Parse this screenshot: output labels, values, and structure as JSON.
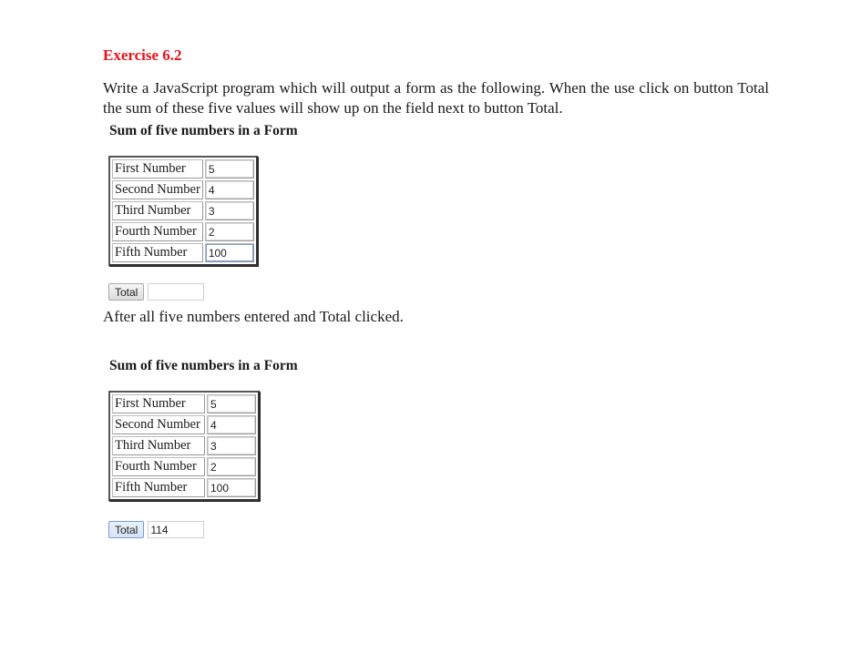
{
  "exercise_title": "Exercise 6.2",
  "instructions": "Write a JavaScript program which will output a form as the following. When the use click on button Total the sum of these five values will show up on the field next to button Total.",
  "form_heading": "Sum of five numbers in a Form",
  "after_text": "After all five numbers entered and Total clicked.",
  "form_before": {
    "rows": [
      {
        "label": "First Number",
        "value": "5"
      },
      {
        "label": "Second Number",
        "value": "4"
      },
      {
        "label": "Third Number",
        "value": "3"
      },
      {
        "label": "Fourth Number",
        "value": "2"
      },
      {
        "label": "Fifth Number",
        "value": "100"
      }
    ],
    "total_button": "Total",
    "total_value": ""
  },
  "form_after": {
    "rows": [
      {
        "label": "First Number",
        "value": "5"
      },
      {
        "label": "Second Number",
        "value": "4"
      },
      {
        "label": "Third Number",
        "value": "3"
      },
      {
        "label": "Fourth Number",
        "value": "2"
      },
      {
        "label": "Fifth Number",
        "value": "100"
      }
    ],
    "total_button": "Total",
    "total_value": "114"
  }
}
